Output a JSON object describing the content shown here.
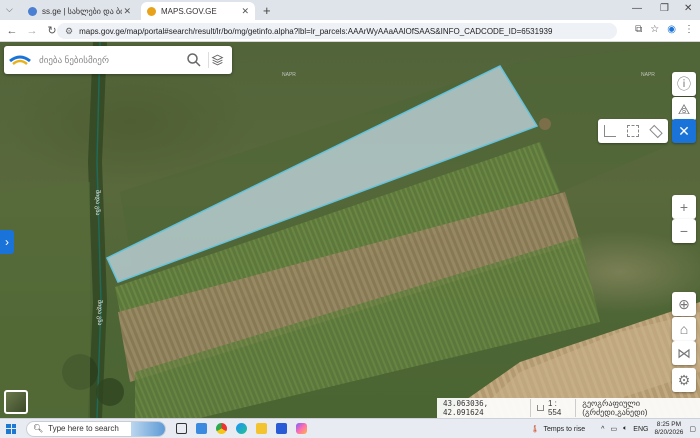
{
  "browser": {
    "tabs": [
      {
        "title": "ss.ge | სახლები და ბინები ყიდვა",
        "active": false,
        "favicon_color": "#4a7fd1"
      },
      {
        "title": "MAPS.GOV.GE",
        "active": true,
        "favicon_color": "#e8a31a"
      }
    ],
    "url": "maps.gov.ge/map/portal#search/result/lr/bo/mg/getinfo.alpha?lbl=lr_parcels:AAArWyAAaAAlOfSAAS&INFO_CADCODE_ID=6531939",
    "icons": [
      "back-icon",
      "forward-icon",
      "reload-icon",
      "tune-icon",
      "install-icon",
      "star-icon",
      "profile-icon",
      "menu-icon"
    ]
  },
  "map": {
    "search_placeholder": "ძიება ნებისმიერ",
    "labels": {
      "road_1": "შიდა გზა",
      "road_2": "შიდა გზა",
      "top_1": "NAPR",
      "top_2": "NAPR"
    },
    "status": {
      "coordinates": "43.063036, 42.091624",
      "scale": "1 : 554",
      "projection": "გეოგრაფიული (გრძედი,განედი)"
    },
    "parcel_color": "#a8c8d8",
    "accent": "#1a73d9"
  },
  "taskbar": {
    "search_placeholder": "Type here to search",
    "weather": "Temps to rise",
    "language": "ENG",
    "time": "8:25 PM",
    "date": "8/20/2026"
  }
}
